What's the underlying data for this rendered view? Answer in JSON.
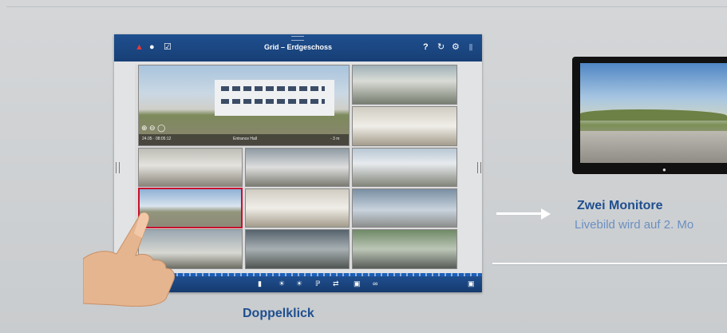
{
  "tablet": {
    "header": {
      "title": "Grid – Erdgeschoss",
      "icons": [
        "alarm-icon",
        "chat-icon",
        "checkbox-icon",
        "help-icon",
        "refresh-icon",
        "gear-icon"
      ],
      "help_glyph": "?",
      "refresh_glyph": "↻",
      "gear_glyph": "⚙",
      "check_glyph": "☑"
    },
    "large_camera": {
      "timestamp": "24.05 · 08:05:12",
      "mode": "Entrance Hall",
      "duration": "- 3 m"
    },
    "footer_icons": [
      "layout-icon",
      "door-icon",
      "brightness-icon",
      "brightness-dim-icon",
      "light-icon",
      "temperature-icon",
      "swap-icon",
      "camera-icon",
      "link-icon",
      "lock-icon"
    ],
    "colors": {
      "header_blue": "#1f4f8f",
      "selection_red": "#c8102e"
    }
  },
  "captions": {
    "action": "Doppelklick",
    "monitor_title": "Zwei Monitore",
    "monitor_text": "Livebild wird auf 2. Mo"
  }
}
